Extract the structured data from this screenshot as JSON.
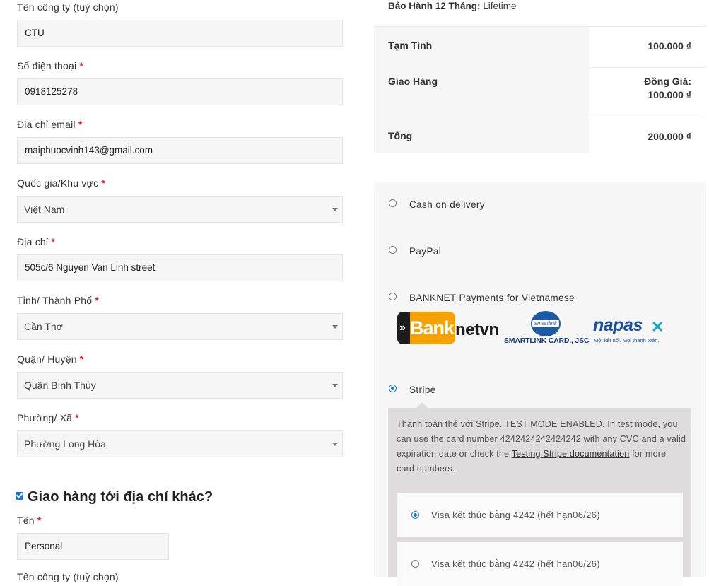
{
  "billing": {
    "company": {
      "label": "Tên công ty (tuỳ chọn)",
      "value": "CTU"
    },
    "phone": {
      "label": "Số điện thoại",
      "required": "*",
      "value": "0918125278"
    },
    "email": {
      "label": "Địa chỉ email",
      "required": "*",
      "value": "maiphuocvinh143@gmail.com"
    },
    "country": {
      "label": "Quốc gia/Khu vực",
      "required": "*",
      "value": "Việt Nam"
    },
    "address": {
      "label": "Địa chỉ",
      "required": "*",
      "value": "505c/6 Nguyen Van Linh street"
    },
    "city": {
      "label": "Tỉnh/ Thành Phố",
      "required": "*",
      "value": "Cần Thơ"
    },
    "district": {
      "label": "Quận/ Huyện",
      "required": "*",
      "value": "Quận Bình Thủy"
    },
    "ward": {
      "label": "Phường/ Xã",
      "required": "*",
      "value": "Phường Long Hòa"
    }
  },
  "shipping": {
    "toggle_label": "Giao hàng tới địa chỉ khác?",
    "checked": true,
    "name": {
      "label": "Tên",
      "required": "*",
      "value": "Personal"
    },
    "company_label_partial": "Tên công ty (tuỳ chọn)"
  },
  "order": {
    "warranty": {
      "label": "Bảo Hành 12 Tháng:",
      "value": "Lifetime"
    },
    "subtotal": {
      "label": "Tạm Tính",
      "value": "100.000 ₫"
    },
    "shipping": {
      "label": "Giao Hàng",
      "value_line1": "Đồng Giá:",
      "value_line2": "100.000 ₫"
    },
    "total": {
      "label": "Tổng",
      "value": "200.000 ₫"
    }
  },
  "payment": {
    "methods": [
      {
        "label": "Cash on delivery",
        "selected": false
      },
      {
        "label": "PayPal",
        "selected": false
      },
      {
        "label": "BANKNET Payments for Vietnamese",
        "selected": false
      },
      {
        "label": "Stripe",
        "selected": true
      }
    ],
    "logos": {
      "banknet_part1": "Bank",
      "banknet_part2": "netvn",
      "smartlink_badge": "smartlink",
      "smartlink_text": "SMARTLINK CARD., JSC",
      "napas_text": "napas",
      "napas_sub": "Một kết nối. Mọi thanh toán."
    },
    "stripe": {
      "description_before": "Thanh toán thẻ với Stripe. TEST MODE ENABLED. In test mode, you can use the card number 4242424242424242 with any CVC and a valid expiration date or check the ",
      "link_text": "Testing Stripe documentation",
      "description_after": " for more card numbers.",
      "saved_cards": [
        {
          "label": "Visa kết thúc bằng 4242 (hết hạn06/26)",
          "selected": true
        },
        {
          "label": "Visa kết thúc bằng 4242 (hết hạn06/26)",
          "selected": false
        }
      ]
    }
  },
  "colors": {
    "required": "#e01b24",
    "accent": "#1976d2",
    "field_bg": "#f6f6f6",
    "stripe_box": "#dedcdc"
  }
}
